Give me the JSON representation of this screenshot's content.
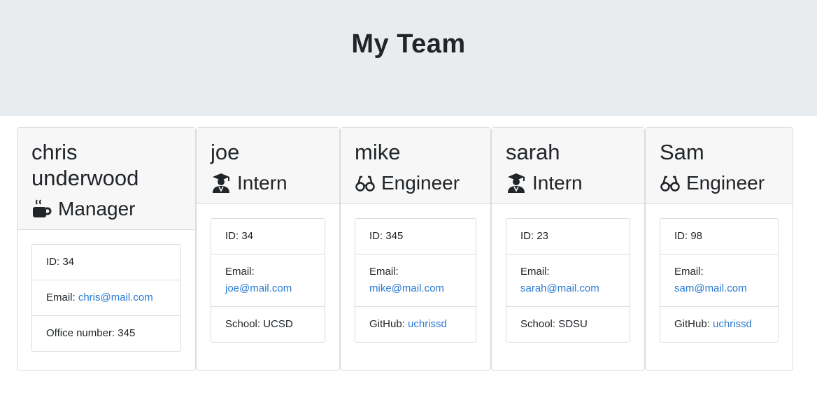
{
  "header": {
    "title": "My Team"
  },
  "cards": [
    {
      "name": "chris underwood",
      "role": "Manager",
      "icon": "coffee-icon",
      "id_label": "ID: 34",
      "email_label": "Email: ",
      "email": "chris@mail.com",
      "extra_label": "Office number: 345",
      "extra_link": ""
    },
    {
      "name": "joe",
      "role": "Intern",
      "icon": "graduate-icon",
      "id_label": "ID: 34",
      "email_label": "Email:",
      "email": "joe@mail.com",
      "extra_label": "School: UCSD",
      "extra_link": ""
    },
    {
      "name": "mike",
      "role": "Engineer",
      "icon": "glasses-icon",
      "id_label": "ID: 345",
      "email_label": "Email:",
      "email": "mike@mail.com",
      "extra_label": "GitHub: ",
      "extra_link": "uchrissd"
    },
    {
      "name": "sarah",
      "role": "Intern",
      "icon": "graduate-icon",
      "id_label": "ID: 23",
      "email_label": "Email:",
      "email": "sarah@mail.com",
      "extra_label": "School: SDSU",
      "extra_link": ""
    },
    {
      "name": "Sam",
      "role": "Engineer",
      "icon": "glasses-icon",
      "id_label": "ID: 98",
      "email_label": "Email:",
      "email": "sam@mail.com",
      "extra_label": "GitHub: ",
      "extra_link": "uchrissd"
    }
  ],
  "colors": {
    "jumbotron": "#e9ecef",
    "link": "#2a7ad2",
    "header_bg": "#f7f7f7"
  }
}
